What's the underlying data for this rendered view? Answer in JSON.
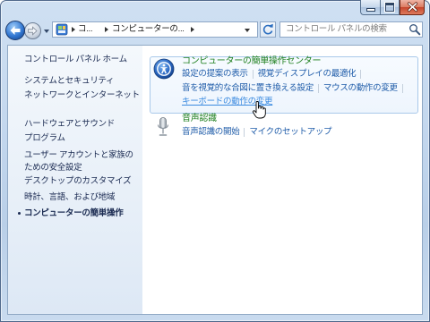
{
  "window": {
    "caption_icons": [
      "minimize-icon",
      "maximize-icon",
      "close-icon"
    ]
  },
  "address_bar": {
    "back_icon": "back-arrow-icon",
    "forward_icon": "forward-arrow-icon",
    "location_icon": "control-panel-icon",
    "breadcrumb": [
      "コ...",
      "コンピューターの..."
    ],
    "refresh_icon": "refresh-icon",
    "search": {
      "placeholder": "コントロール パネルの検索",
      "value": "",
      "icon": "search-icon"
    }
  },
  "nav": {
    "home": "コントロール パネル ホーム",
    "items": [
      {
        "lines": [
          "システムとセキュリティ"
        ]
      },
      {
        "lines": [
          "ネットワークとインターネット"
        ]
      },
      {
        "lines": [
          "ハードウェアとサウンド"
        ]
      },
      {
        "lines": [
          "プログラム"
        ]
      },
      {
        "lines": [
          "ユーザー アカウントと家族の",
          "ための安全設定"
        ]
      },
      {
        "lines": [
          "デスクトップのカスタマイズ"
        ]
      },
      {
        "lines": [
          "時計、言語、および地域"
        ]
      },
      {
        "lines": [
          "コンピューターの簡単操作"
        ],
        "current": true
      }
    ]
  },
  "main": {
    "sections": [
      {
        "icon": "ease-of-access-icon",
        "heading": "コンピューターの簡単操作センター",
        "hovered": true,
        "link_rows": [
          [
            {
              "label": "設定の提案の表示"
            },
            {
              "label": "視覚ディスプレイの最適化"
            }
          ],
          [
            {
              "label": "音を視覚的な合図に置き換える設定"
            },
            {
              "label": "マウスの動作の変更"
            }
          ],
          [
            {
              "label": "キーボードの動作の変更",
              "hovered": true
            }
          ]
        ]
      },
      {
        "icon": "microphone-icon",
        "heading": "音声認識",
        "link_rows": [
          [
            {
              "label": "音声認識の開始"
            },
            {
              "label": "マイクのセットアップ"
            }
          ]
        ]
      }
    ],
    "cursor_icon": "hand-pointer-icon"
  },
  "colors": {
    "link": "#1f5ca9",
    "link_hover": "#3a8ae0",
    "heading": "#1e7f1e",
    "nav_text": "#1b2b52",
    "glass": "#c3d7ee"
  }
}
